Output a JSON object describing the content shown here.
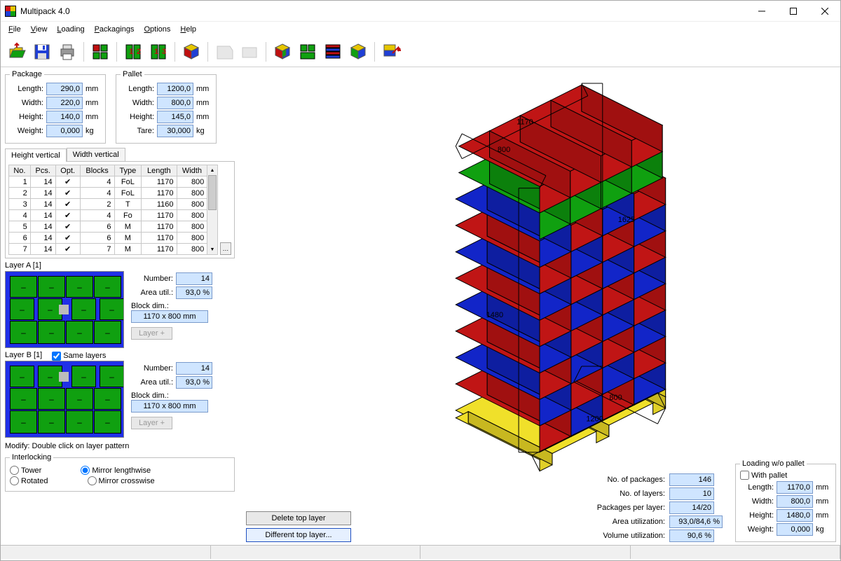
{
  "app": {
    "title": "Multipack 4.0"
  },
  "menu": {
    "file": "File",
    "view": "View",
    "loading": "Loading",
    "packagings": "Packagings",
    "options": "Options",
    "help": "Help"
  },
  "groups": {
    "package": {
      "legend": "Package",
      "length_lbl": "Length:",
      "length": "290,0",
      "length_u": "mm",
      "width_lbl": "Width:",
      "width": "220,0",
      "width_u": "mm",
      "height_lbl": "Height:",
      "height": "140,0",
      "height_u": "mm",
      "weight_lbl": "Weight:",
      "weight": "0,000",
      "weight_u": "kg"
    },
    "pallet": {
      "legend": "Pallet",
      "length_lbl": "Length:",
      "length": "1200,0",
      "length_u": "mm",
      "width_lbl": "Width:",
      "width": "800,0",
      "width_u": "mm",
      "height_lbl": "Height:",
      "height": "145,0",
      "height_u": "mm",
      "tare_lbl": "Tare:",
      "tare": "30,000",
      "tare_u": "kg"
    }
  },
  "tabs": {
    "hv": "Height vertical",
    "wv": "Width vertical"
  },
  "table": {
    "headers": [
      "No.",
      "Pcs.",
      "Opt.",
      "Blocks",
      "Type",
      "Length",
      "Width"
    ],
    "rows": [
      {
        "no": "1",
        "pcs": "14",
        "opt": "✔",
        "blocks": "4",
        "type": "FoL",
        "length": "1170",
        "width": "800"
      },
      {
        "no": "2",
        "pcs": "14",
        "opt": "✔",
        "blocks": "4",
        "type": "FoL",
        "length": "1170",
        "width": "800"
      },
      {
        "no": "3",
        "pcs": "14",
        "opt": "✔",
        "blocks": "2",
        "type": "T",
        "length": "1160",
        "width": "800"
      },
      {
        "no": "4",
        "pcs": "14",
        "opt": "✔",
        "blocks": "4",
        "type": "Fo",
        "length": "1170",
        "width": "800"
      },
      {
        "no": "5",
        "pcs": "14",
        "opt": "✔",
        "blocks": "6",
        "type": "M",
        "length": "1170",
        "width": "800"
      },
      {
        "no": "6",
        "pcs": "14",
        "opt": "✔",
        "blocks": "6",
        "type": "M",
        "length": "1170",
        "width": "800"
      },
      {
        "no": "7",
        "pcs": "14",
        "opt": "✔",
        "blocks": "7",
        "type": "M",
        "length": "1170",
        "width": "800"
      }
    ]
  },
  "layerA": {
    "title": "Layer A [1]",
    "number_lbl": "Number:",
    "number": "14",
    "area_lbl": "Area util.:",
    "area": "93,0 %",
    "block_lbl": "Block dim.:",
    "block": "1170 x 800 mm",
    "layer_btn": "Layer +"
  },
  "layerB": {
    "title": "Layer B [1]",
    "same_lbl": "Same layers",
    "number_lbl": "Number:",
    "number": "14",
    "area_lbl": "Area util.:",
    "area": "93,0 %",
    "block_lbl": "Block dim.:",
    "block": "1170 x 800 mm",
    "layer_btn": "Layer +"
  },
  "modify_hint": "Modify: Double click on layer pattern",
  "interlock": {
    "legend": "Interlocking",
    "tower": "Tower",
    "mirror_l": "Mirror lengthwise",
    "rotated": "Rotated",
    "mirror_c": "Mirror crosswise"
  },
  "buttons": {
    "delete_top": "Delete top layer",
    "diff_top": "Different top layer..."
  },
  "stats": {
    "no_pkg_lbl": "No. of packages:",
    "no_pkg": "146",
    "no_lay_lbl": "No. of layers:",
    "no_lay": "10",
    "ppl_lbl": "Packages per layer:",
    "ppl": "14/20",
    "area_lbl": "Area utilization:",
    "area": "93,0/84,6 %",
    "vol_lbl": "Volume utilization:",
    "vol": "90,6 %"
  },
  "loading": {
    "legend": "Loading w/o pallet",
    "with_pallet": "With pallet",
    "length_lbl": "Length:",
    "length": "1170,0",
    "u_mm": "mm",
    "width_lbl": "Width:",
    "width": "800,0",
    "height_lbl": "Height:",
    "height": "1480,0",
    "weight_lbl": "Weight:",
    "weight": "0,000",
    "u_kg": "kg"
  },
  "dims3d": {
    "top_w": "800",
    "top_l": "1170",
    "left_h": "1480",
    "right_h": "1625",
    "base_l": "1200",
    "base_w": "800"
  }
}
